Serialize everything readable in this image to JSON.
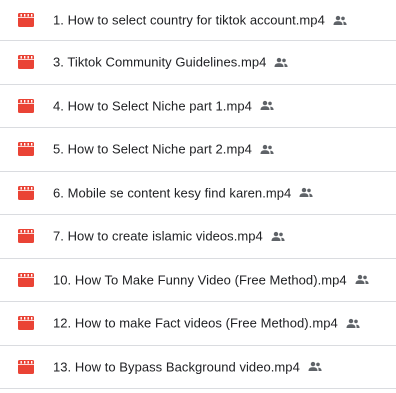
{
  "files": [
    {
      "name": "1. How to select country for tiktok account.mp4",
      "file_icon": "video-file-icon",
      "shared_icon": "people-icon"
    },
    {
      "name": "3. Tiktok Community Guidelines.mp4",
      "file_icon": "video-file-icon",
      "shared_icon": "people-icon"
    },
    {
      "name": "4. How to Select Niche part 1.mp4",
      "file_icon": "video-file-icon",
      "shared_icon": "people-icon"
    },
    {
      "name": "5. How to Select Niche part 2.mp4",
      "file_icon": "video-file-icon",
      "shared_icon": "people-icon"
    },
    {
      "name": "6. Mobile se content kesy find karen.mp4",
      "file_icon": "video-file-icon",
      "shared_icon": "people-icon"
    },
    {
      "name": "7. How to create islamic videos.mp4",
      "file_icon": "video-file-icon",
      "shared_icon": "people-icon"
    },
    {
      "name": "10. How To Make Funny Video (Free Method).mp4",
      "file_icon": "video-file-icon",
      "shared_icon": "people-icon"
    },
    {
      "name": "12. How to make Fact videos (Free Method).mp4",
      "file_icon": "video-file-icon",
      "shared_icon": "people-icon"
    },
    {
      "name": "13. How to Bypass Background video.mp4",
      "file_icon": "video-file-icon",
      "shared_icon": "people-icon"
    }
  ],
  "colors": {
    "video_icon": "#ea4335",
    "text": "#202124",
    "shared_icon": "#5f6368",
    "divider": "#dadce0"
  }
}
